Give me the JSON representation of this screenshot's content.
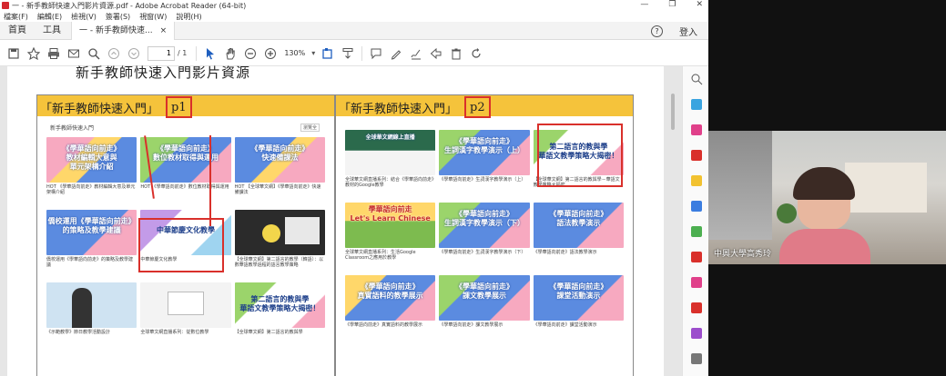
{
  "window": {
    "title": "一 - 新手教師快速入門影片資源.pdf - Adobe Acrobat Reader (64-bit)",
    "controls": [
      "—",
      "❐",
      "✕"
    ]
  },
  "menu": [
    "檔案(F)",
    "編輯(E)",
    "檢視(V)",
    "簽署(S)",
    "視窗(W)",
    "說明(H)"
  ],
  "tabs": {
    "home": "首頁",
    "tools": "工具",
    "document": "一 - 新手教師快速...",
    "close": "×",
    "help": "?",
    "signin": "登入"
  },
  "toolbar": {
    "page_current": "1",
    "page_total": "/ 1",
    "zoom": "130%"
  },
  "page": {
    "heading": "新手教師快速入門影片資源",
    "left": {
      "header_text": "「新手教師快速入門」",
      "header_tag": "p1",
      "panel_label": "新手教師快速入門",
      "panel_btn": "瀏覽全",
      "rows": [
        [
          {
            "title": "《學華語向前走》\n教材編輯大意與\n單元架構介紹",
            "caption": "HOT 《學華語向前走》教材編輯大意及單元架構介紹"
          },
          {
            "title": "《學華語向前走》\n數位教材取得與運用",
            "caption": "HOT 《學華語向前走》數位教材取得與運用"
          },
          {
            "title": "《學華語向前走》\n快速備課法",
            "caption": "HOT 【全球華文網】《學華語向前走》快速備課法"
          }
        ],
        [
          {
            "title": "僑校運用《學華語向前走》\n的策略及教學建議",
            "caption": "僑校運用《學華語向前走》的策略及教學建議"
          },
          {
            "title": "中華節慶文化教學",
            "caption": "中華節慶文化教學"
          },
          {
            "title": "",
            "caption": "【全球華文網】第二語言的教學（韓語）：以數華語教學過程的語言教學策略"
          }
        ],
        [
          {
            "title": "",
            "caption": "《示範教學》節日教學活動設計"
          },
          {
            "title": "",
            "caption": "全球華文網直播系列：從數位教學"
          },
          {
            "title": "第二語言的教與學\n華語文教學策略大揭密！",
            "caption": "【全球華文網】第二語言的教與學"
          }
        ]
      ]
    },
    "right": {
      "header_text": "「新手教師快速入門」",
      "header_tag": "p2",
      "rows": [
        [
          {
            "title": "全球華文網線上直播",
            "caption": "全球華文網直播系列：結合《學華語向前走》教材的Google教學"
          },
          {
            "title": "《學華語向前走》\n生詞漢字教學演示（上）",
            "caption": "《學華語向前走》生詞漢字教學演示（上）"
          },
          {
            "title": "第二語言的教與學\n華語文教學策略大揭密！",
            "caption": "【全球華文網】第二語言的教與學－華語文教學策略大揭密"
          }
        ],
        [
          {
            "title": "學華語向前走\nLet's Learn Chinese",
            "caption": "全球華文網直播系列：生活Google Classroom之應用於教學"
          },
          {
            "title": "《學華語向前走》\n生詞漢字教學演示（下）",
            "caption": "《學華語向前走》生詞漢字教學演示（下）"
          },
          {
            "title": "《學華語向前走》\n語法教學演示",
            "caption": "《學華語向前走》語法教學演示"
          }
        ],
        [
          {
            "title": "《學華語向前走》\n真實語料的教學展示",
            "caption": "《學華語向前走》真實語料的教學展示"
          },
          {
            "title": "《學華語向前走》\n課文教學展示",
            "caption": "《學華語向前走》課文教學展示"
          },
          {
            "title": "《學華語向前走》\n課堂活動演示",
            "caption": "《學華語向前走》課堂活動演示"
          }
        ]
      ]
    }
  },
  "video": {
    "name_label": "中興大學高秀玲"
  },
  "colors": {
    "accent_red": "#d9302b",
    "header_yellow": "#f5c33b",
    "thumb_blue": "#4d7fd4",
    "thumb_pink": "#f08ca8",
    "thumb_green": "#9bd46b"
  },
  "icons": {
    "toolbar": [
      "save-icon",
      "star-icon",
      "print-icon",
      "mail-icon",
      "zoom-search-icon",
      "page-up-icon",
      "page-down-icon",
      "cursor-icon",
      "hand-icon",
      "zoom-out-icon",
      "zoom-in-icon",
      "fit-page-icon",
      "scroll-icon",
      "comment-icon",
      "pen-icon",
      "sign-icon",
      "share-icon",
      "trash-icon",
      "rotate-icon"
    ],
    "sidebar": [
      "zoom-tool-icon",
      "export-pdf-icon",
      "edit-pdf-icon",
      "create-pdf-icon",
      "comment-tool-icon",
      "combine-icon",
      "organize-icon",
      "compress-icon",
      "redact-icon",
      "protect-icon",
      "fill-sign-icon",
      "more-tools-icon"
    ]
  }
}
